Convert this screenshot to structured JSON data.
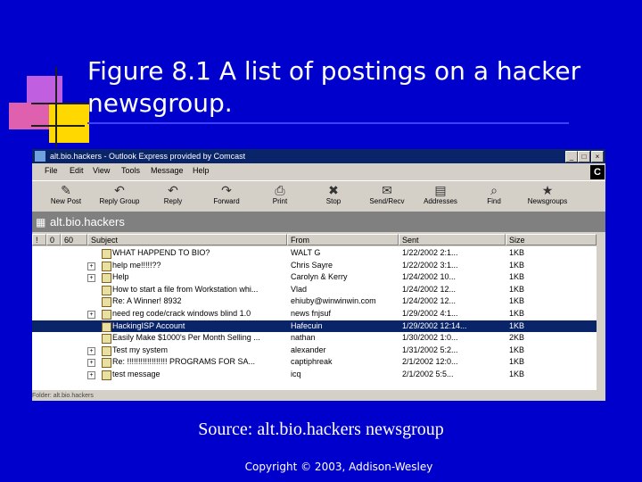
{
  "slide": {
    "title": "Figure 8.1 A list of postings on a hacker newsgroup.",
    "source": "Source: alt.bio.hackers newsgroup",
    "copyright": "Copyright © 2003, Addison-Wesley"
  },
  "window": {
    "title": "alt.bio.hackers - Outlook Express provided by Comcast",
    "brand": "C",
    "menus": [
      "File",
      "Edit",
      "View",
      "Tools",
      "Message",
      "Help"
    ],
    "toolbar": [
      {
        "label": "New Post",
        "icon": "new-post-icon",
        "glyph": "✎"
      },
      {
        "label": "Reply Group",
        "icon": "reply-group-icon",
        "glyph": "↶"
      },
      {
        "label": "Reply",
        "icon": "reply-icon",
        "glyph": "↶"
      },
      {
        "label": "Forward",
        "icon": "forward-icon",
        "glyph": "↷"
      },
      {
        "label": "Print",
        "icon": "print-icon",
        "glyph": "⎙"
      },
      {
        "label": "Stop",
        "icon": "stop-icon",
        "glyph": "✖"
      },
      {
        "label": "Send/Recv",
        "icon": "send-receive-icon",
        "glyph": "✉"
      },
      {
        "label": "Addresses",
        "icon": "addresses-icon",
        "glyph": "▤"
      },
      {
        "label": "Find",
        "icon": "find-icon",
        "glyph": "⌕"
      },
      {
        "label": "Newsgroups",
        "icon": "newsgroups-icon",
        "glyph": "★"
      }
    ],
    "folder": "alt.bio.hackers",
    "columns": {
      "flag": "!",
      "attach": "0",
      "watch": "60",
      "subject": "Subject",
      "from": "From",
      "sent": "Sent",
      "size": "Size"
    },
    "messages": [
      {
        "expand": "",
        "subject": "WHAT HAPPEND TO BIO?",
        "from": "WALT G",
        "sent": "1/22/2002 2:1...",
        "size": "1KB",
        "selected": false
      },
      {
        "expand": "+",
        "subject": "help me!!!!!??",
        "from": "Chris Sayre",
        "sent": "1/22/2002 3:1...",
        "size": "1KB",
        "selected": false
      },
      {
        "expand": "+",
        "subject": "Help",
        "from": "Carolyn & Kerry",
        "sent": "1/24/2002 10...",
        "size": "1KB",
        "selected": false
      },
      {
        "expand": "",
        "subject": "How to start a file from Workstation whi...",
        "from": "Vlad",
        "sent": "1/24/2002 12...",
        "size": "1KB",
        "selected": false
      },
      {
        "expand": "",
        "subject": "Re: A Winner! 8932",
        "from": "ehiuby@winwinwin.com",
        "sent": "1/24/2002 12...",
        "size": "1KB",
        "selected": false
      },
      {
        "expand": "+",
        "subject": "need reg code/crack windows blind 1.0",
        "from": "news fnjsuf",
        "sent": "1/29/2002 4:1...",
        "size": "1KB",
        "selected": false
      },
      {
        "expand": "",
        "subject": "HackingISP Account",
        "from": "Hafecuin",
        "sent": "1/29/2002 12:14...",
        "size": "1KB",
        "selected": true
      },
      {
        "expand": "",
        "subject": "Easily Make $1000's Per Month Selling ...",
        "from": "nathan",
        "sent": "1/30/2002 1:0...",
        "size": "2KB",
        "selected": false
      },
      {
        "expand": "+",
        "subject": "Test my system",
        "from": "alexander",
        "sent": "1/31/2002 5:2...",
        "size": "1KB",
        "selected": false
      },
      {
        "expand": "+",
        "subject": "Re: !!!!!!!!!!!!!!!!!! PROGRAMS FOR SA...",
        "from": "captiphreak",
        "sent": "2/1/2002 12:0...",
        "size": "1KB",
        "selected": false
      },
      {
        "expand": "+",
        "subject": "test message",
        "from": "icq",
        "sent": "2/1/2002 5:5...",
        "size": "1KB",
        "selected": false
      }
    ],
    "status": "Folder: alt.bio.hackers"
  }
}
